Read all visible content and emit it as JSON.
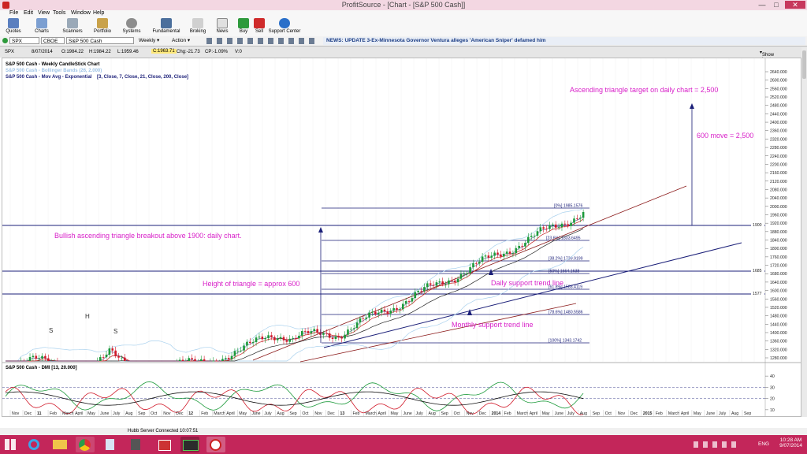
{
  "window": {
    "title": "ProfitSource - [Chart - [S&P 500 Cash]]",
    "min": "—",
    "max": "□",
    "close": "✕"
  },
  "menu": [
    "File",
    "Edit",
    "View",
    "Tools",
    "Window",
    "Help"
  ],
  "toolbar": [
    "Quotes",
    "Charts",
    "Scanners",
    "Portfolio",
    "Systems",
    "Fundamental",
    "Broking",
    "News",
    "Buy",
    "Sell",
    "Support Center"
  ],
  "symbolbar": {
    "symbol": "SPX",
    "exchange": "CBOE",
    "name": "S&P 500 Cash",
    "period": "Weekly",
    "action": "Action",
    "news": "NEWS: UPDATE 3-Ex-Minnesota Governor Ventura alleges 'American Sniper' defamed him"
  },
  "quote": {
    "sym": "SPX",
    "date": "8/07/2014",
    "open": "O:1984.22",
    "high": "H:1984.22",
    "low": "L:1959.46",
    "close": "C:1963.71",
    "chg": "Chg:-21.73",
    "chgpct": "CP:-1.09%",
    "vol": "V:0",
    "show_last": "Show Last"
  },
  "legend": {
    "l1": "S&P 500 Cash - Weekly CandleStick Chart",
    "l2": "S&P 500 Cash - Bollinger Bands (26, 2.000)",
    "l3a": "S&P 500 Cash - Mov Avg - Exponential",
    "l3b": "[3, Close, 7, Close, 21, Close, 200, Close]",
    "dmi": "S&P 500 Cash - DMI [13, 20.000]"
  },
  "price_axis": [
    "2640.000",
    "2600.000",
    "2560.000",
    "2520.000",
    "2480.000",
    "2440.000",
    "2400.000",
    "2360.000",
    "2320.000",
    "2280.000",
    "2240.000",
    "2200.000",
    "2160.000",
    "2120.000",
    "2080.000",
    "2040.000",
    "2000.000",
    "1960.000",
    "1920.000",
    "1880.000",
    "1840.000",
    "1800.000",
    "1760.000",
    "1720.000",
    "1680.000",
    "1640.000",
    "1600.000",
    "1560.000",
    "1520.000",
    "1480.000",
    "1440.000",
    "1400.000",
    "1360.000",
    "1320.000",
    "1280.000"
  ],
  "dmi_axis": [
    "40",
    "30",
    "20",
    "10"
  ],
  "fib": [
    "[0%] 1985.1576",
    "[23.6%] 1833.6495",
    "[38.2%] 1739.9199",
    "[50%] 1664.1638",
    "[61.8%] 1588.4119",
    "[78.6%] 1480.5586",
    "[100%] 1343.1742"
  ],
  "level_tags": [
    "1900",
    "1685",
    "1577"
  ],
  "annotations": {
    "target": "Ascending triangle target on daily chart = 2,500",
    "move": "600 move = 2,500",
    "breakout": "Bullish ascending triangle breakout above 1900: daily chart.",
    "height": "Height of triangle = approx 600",
    "daily": "Daily support trend line",
    "monthly": "Monthly support trend line",
    "s1": "S",
    "h": "H",
    "s2": "S"
  },
  "time_axis": [
    "Nov",
    "Dec",
    "|11",
    "Feb",
    "March",
    "April",
    "May",
    "June",
    "July",
    "Aug",
    "Sep",
    "Oct",
    "Nov",
    "Dec",
    "|12",
    "Feb",
    "March",
    "April",
    "May",
    "June",
    "July",
    "Aug",
    "Sep",
    "Oct",
    "Nov",
    "Dec",
    "|13",
    "Feb",
    "March",
    "April",
    "May",
    "June",
    "July",
    "Aug",
    "Sep",
    "Oct",
    "Nov",
    "Dec",
    "|2014",
    "Feb",
    "March",
    "April",
    "May",
    "June",
    "July",
    "Aug",
    "Sep",
    "Oct",
    "Nov",
    "Dec",
    "|2015",
    "Feb",
    "March",
    "April",
    "May",
    "June",
    "July",
    "Aug",
    "Sep"
  ],
  "status": "Hubb Server Connected 10:07:51",
  "clock": {
    "time": "10:28 AM",
    "date": "9/07/2014",
    "lang": "ENG"
  },
  "colors": {
    "magenta": "#d81fc8",
    "navy": "#1b1f78",
    "bull": "#1c9a3a",
    "bear": "#d11a2a"
  }
}
